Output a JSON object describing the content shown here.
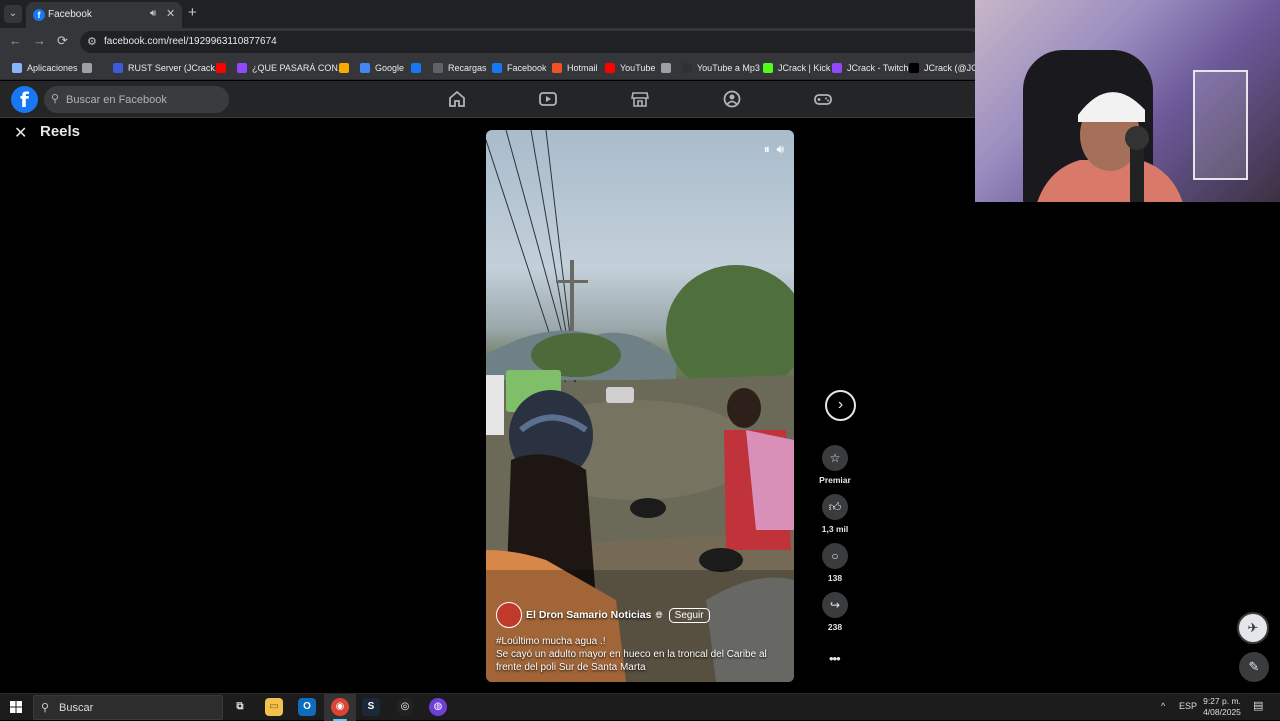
{
  "browser": {
    "tab": {
      "title": "Facebook",
      "favicon": "facebook-icon"
    },
    "url": "facebook.com/reel/1929963110877674",
    "bookmarks": [
      {
        "label": "Aplicaciones",
        "icon": "apps-grid-icon",
        "color": "#8ab4f8"
      },
      {
        "label": "",
        "icon": "grid-icon",
        "color": "#9aa0a6"
      },
      {
        "label": "RUST Server (JCrack...",
        "icon": "rust-icon",
        "color": "#3b5bdb"
      },
      {
        "label": "",
        "icon": "youtube-icon",
        "color": "#ff0000"
      },
      {
        "label": "¿QUE PASARÁ CON...",
        "icon": "twitch-icon",
        "color": "#9146ff"
      },
      {
        "label": "",
        "icon": "star-icon",
        "color": "#f9ab00"
      },
      {
        "label": "Google",
        "icon": "google-icon",
        "color": "#4285f4"
      },
      {
        "label": "",
        "icon": "facebook-icon",
        "color": "#1877f2"
      },
      {
        "label": "Recargas",
        "icon": "recargas-icon",
        "color": "#5f6368"
      },
      {
        "label": "Facebook",
        "icon": "facebook-icon",
        "color": "#1877f2"
      },
      {
        "label": "Hotmail",
        "icon": "windows-icon",
        "color": "#f25022"
      },
      {
        "label": "YouTube",
        "icon": "youtube-icon",
        "color": "#ff0000"
      },
      {
        "label": "",
        "icon": "globe-icon",
        "color": "#9aa0a6"
      },
      {
        "label": "YouTube a Mp3",
        "icon": "mp3-icon",
        "color": "#303134"
      },
      {
        "label": "JCrack | Kick",
        "icon": "kick-icon",
        "color": "#53fc18"
      },
      {
        "label": "JCrack - Twitch",
        "icon": "twitch-icon",
        "color": "#9146ff"
      },
      {
        "label": "JCrack (@JCra",
        "icon": "x-icon",
        "color": "#000000"
      }
    ]
  },
  "facebook": {
    "search_placeholder": "Buscar en Facebook",
    "page_title": "Reels",
    "brand_color": "#1877f2"
  },
  "reel": {
    "channel": "El Dron Samario Noticias",
    "follow_label": "Seguir",
    "caption_line1": "#Loúltimo  mucha agua .!",
    "caption_line2": "Se cayó un adulto mayor en hueco en la troncal del Caribe al frente del poli Sur de Santa Marta",
    "actions": {
      "premiar": "Premiar",
      "likes": "1,3 mil",
      "comments": "138",
      "shares": "238"
    }
  },
  "taskbar": {
    "search_label": "Buscar",
    "language": "ESP",
    "time": "9:27 p. m.",
    "date": "4/08/2025"
  }
}
